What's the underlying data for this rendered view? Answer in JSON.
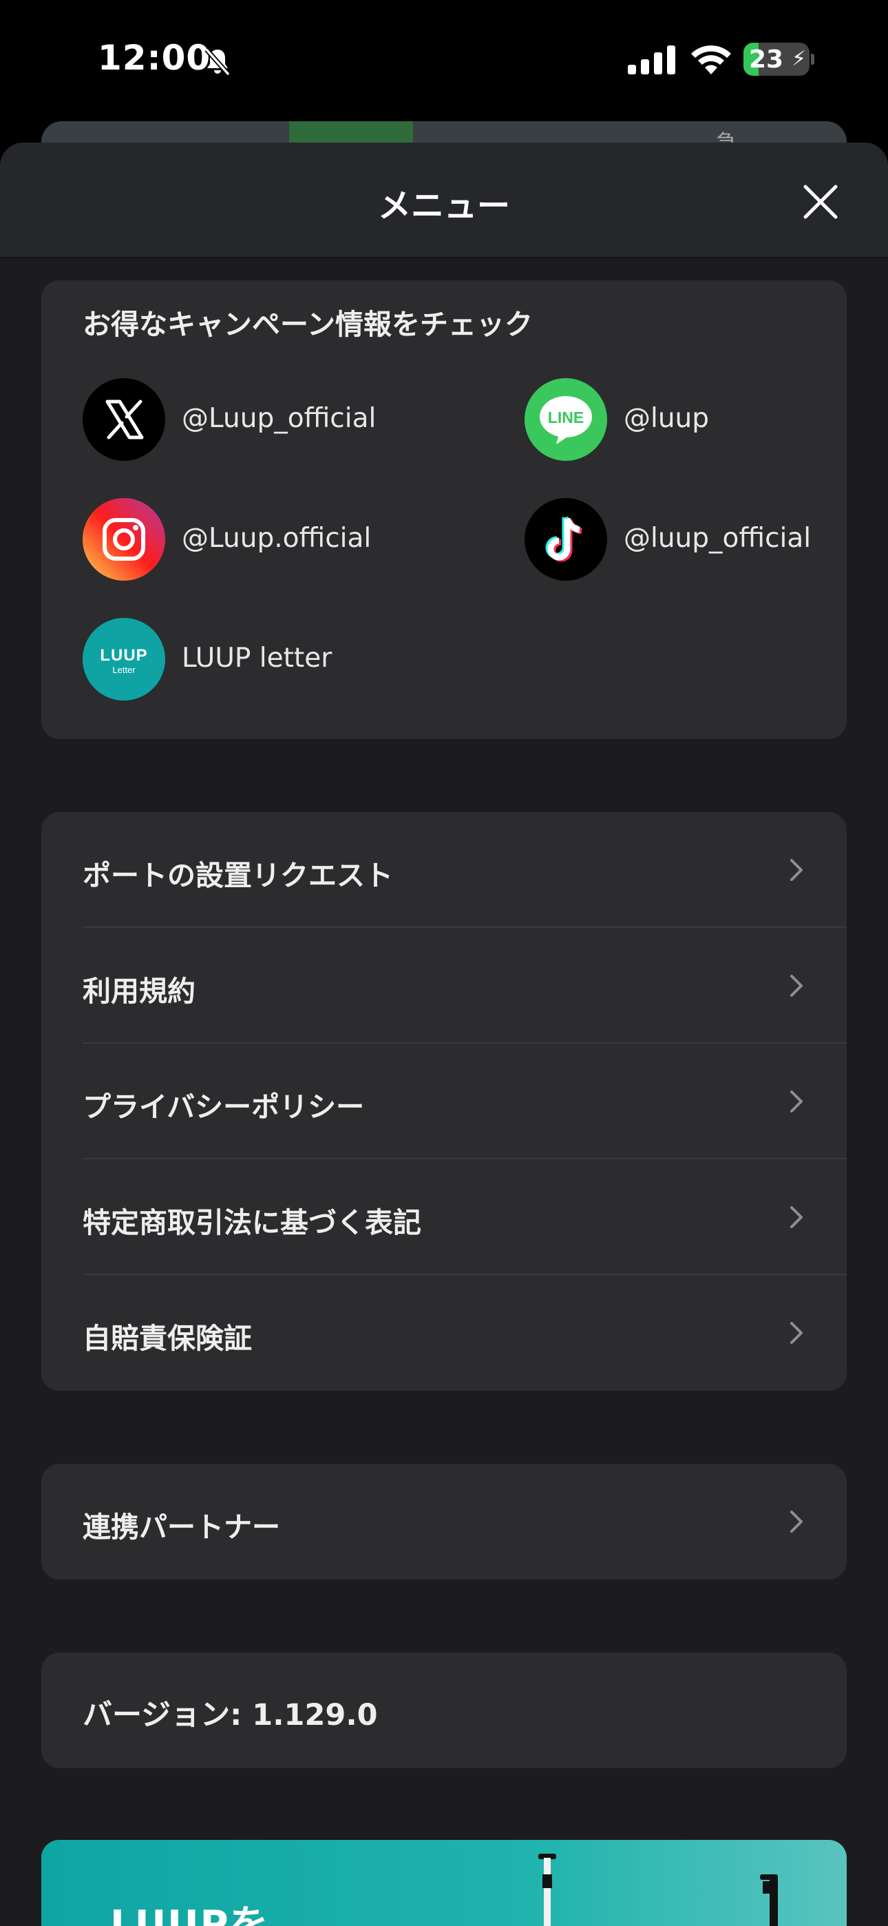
{
  "status_bar": {
    "time": "12:00",
    "battery": "23"
  },
  "sheet": {
    "title": "メニュー"
  },
  "social": {
    "title": "お得なキャンペーン情報をチェック",
    "items": [
      {
        "label": "@Luup_official",
        "icon": "x-logo-icon"
      },
      {
        "label": "@luup",
        "icon": "line-logo-icon",
        "icon_text": "LINE"
      },
      {
        "label": "@Luup.official",
        "icon": "instagram-logo-icon"
      },
      {
        "label": "@luup_official",
        "icon": "tiktok-logo-icon"
      },
      {
        "label": "LUUP letter",
        "icon": "luup-letter-logo-icon",
        "icon_text": "LUUP",
        "icon_subtext": "Letter"
      }
    ]
  },
  "menu": {
    "items": [
      {
        "label": "ポートの設置リクエスト"
      },
      {
        "label": "利用規約"
      },
      {
        "label": "プライバシーポリシー"
      },
      {
        "label": "特定商取引法に基づく表記"
      },
      {
        "label": "自賠責保険証"
      }
    ]
  },
  "partner": {
    "label": "連携パートナー"
  },
  "version": {
    "label": "バージョン: 1.129.0"
  },
  "banner": {
    "text": "LUUPを"
  },
  "colors": {
    "sheet_bg": "#1c1c1e",
    "card_bg": "#2c2c2e",
    "line_green": "#3ac85d",
    "luup_teal": "#0fa3a4",
    "battery_green": "#34c759"
  }
}
